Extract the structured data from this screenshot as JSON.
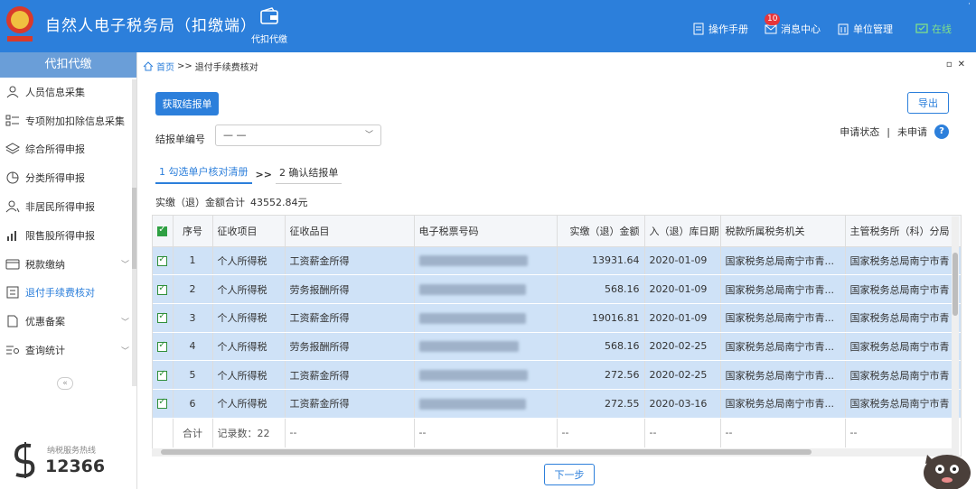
{
  "header": {
    "title": "自然人电子税务局（扣缴端）",
    "nav_tab": "代扣代缴",
    "manual": "操作手册",
    "message_center": "消息中心",
    "message_count": "10",
    "unit_management": "单位管理",
    "online_status": "在线"
  },
  "sidebar": {
    "heading": "代扣代缴",
    "items": [
      {
        "label": "人员信息采集",
        "icon": "person-icon"
      },
      {
        "label": "专项附加扣除信息采集",
        "icon": "list-icon"
      },
      {
        "label": "综合所得申报",
        "icon": "layers-icon"
      },
      {
        "label": "分类所得申报",
        "icon": "pie-icon"
      },
      {
        "label": "非居民所得申报",
        "icon": "person-outline-icon"
      },
      {
        "label": "限售股所得申报",
        "icon": "bar-chart-icon"
      },
      {
        "label": "税款缴纳",
        "icon": "wallet-icon"
      },
      {
        "label": "退付手续费核对",
        "icon": "document-icon"
      },
      {
        "label": "优惠备案",
        "icon": "file-icon"
      },
      {
        "label": "查询统计",
        "icon": "search-list-icon"
      }
    ],
    "hotline_label": "纳税服务热线",
    "hotline_number": "12366"
  },
  "breadcrumb": {
    "home": "首页",
    "separator": ">>",
    "current": "退付手续费核对"
  },
  "toolbar": {
    "fetch_button": "获取结报单",
    "export_button": "导出",
    "status_label": "申请状态",
    "status_divider": "|",
    "status_value": "未申请"
  },
  "form": {
    "report_no_label": "结报单编号",
    "report_no_value": "— —"
  },
  "steps": {
    "step1": "1 勾选单户核对清册",
    "separator": ">>",
    "step2": "2 确认结报单"
  },
  "summary": {
    "label": "实缴（退）金额合计",
    "value": "43552.84元"
  },
  "table": {
    "headers": [
      "序号",
      "征收项目",
      "征收品目",
      "电子税票号码",
      "实缴（退）金额",
      "入（退）库日期",
      "税款所属税务机关",
      "主管税务所（科）分局"
    ],
    "rows": [
      {
        "no": "1",
        "item": "个人所得税",
        "category": "工资薪金所得",
        "amount": "13931.64",
        "date": "2020-01-09",
        "authority": "国家税务总局南宁市青...",
        "branch": "国家税务总局南宁市青"
      },
      {
        "no": "2",
        "item": "个人所得税",
        "category": "劳务报酬所得",
        "amount": "568.16",
        "date": "2020-01-09",
        "authority": "国家税务总局南宁市青...",
        "branch": "国家税务总局南宁市青"
      },
      {
        "no": "3",
        "item": "个人所得税",
        "category": "工资薪金所得",
        "amount": "19016.81",
        "date": "2020-01-09",
        "authority": "国家税务总局南宁市青...",
        "branch": "国家税务总局南宁市青"
      },
      {
        "no": "4",
        "item": "个人所得税",
        "category": "劳务报酬所得",
        "amount": "568.16",
        "date": "2020-02-25",
        "authority": "国家税务总局南宁市青...",
        "branch": "国家税务总局南宁市青"
      },
      {
        "no": "5",
        "item": "个人所得税",
        "category": "工资薪金所得",
        "amount": "272.56",
        "date": "2020-02-25",
        "authority": "国家税务总局南宁市青...",
        "branch": "国家税务总局南宁市青"
      },
      {
        "no": "6",
        "item": "个人所得税",
        "category": "工资薪金所得",
        "amount": "272.55",
        "date": "2020-03-16",
        "authority": "国家税务总局南宁市青...",
        "branch": "国家税务总局南宁市青"
      }
    ],
    "footer": {
      "total_label": "合计",
      "record_count": "记录数：22",
      "placeholder": "--"
    }
  },
  "next_button": "下一步",
  "colors": {
    "header_bg": "#2c7fdb",
    "accent": "#2c7fdb",
    "row_selected": "#cfe2f7",
    "checkbox": "#2fa043"
  }
}
